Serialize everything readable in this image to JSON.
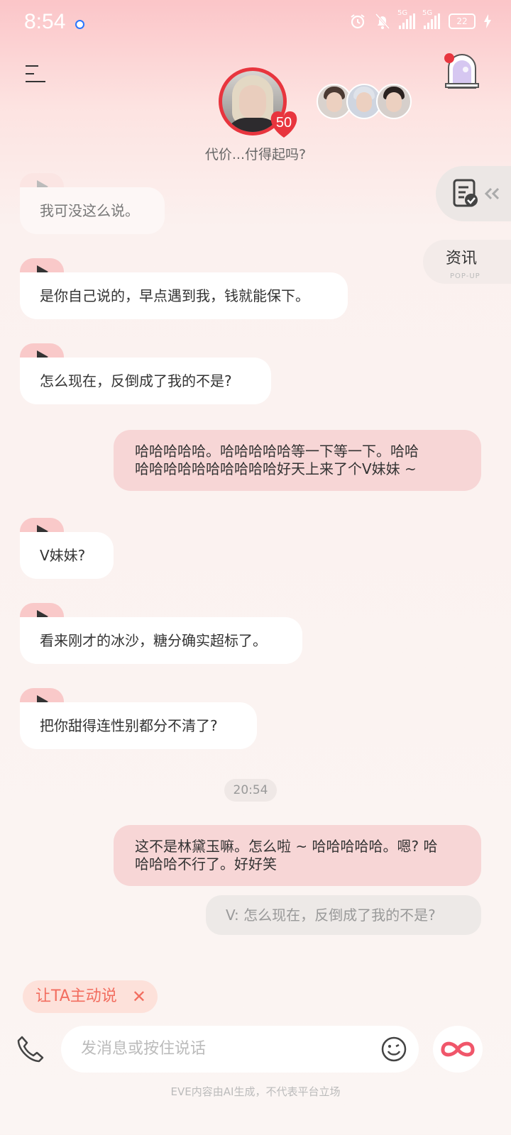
{
  "status_bar": {
    "time": "8:54",
    "network_1": "5G",
    "network_2": "5G",
    "battery": "22"
  },
  "header": {
    "affection_level": "50",
    "subtitle": "代价...付得起吗?",
    "icons": [
      "menu-icon",
      "door-portal-icon"
    ]
  },
  "side": {
    "news_label": "资讯",
    "news_sub": "POP-UP"
  },
  "messages": {
    "m1": "我可没这么说。",
    "m2": "是你自己说的，早点遇到我，钱就能保下。",
    "m3": "怎么现在，反倒成了我的不是?",
    "u1_line1": "哈哈哈哈哈。哈哈哈哈哈等一下等一下。哈哈",
    "u1_line2": "哈哈哈哈哈哈哈哈哈哈好天上来了个V妹妹 ~",
    "m4": "V妹妹?",
    "m5": "看来刚才的冰沙，糖分确实超标了。",
    "m6": "把你甜得连性别都分不清了?",
    "timestamp": "20:54",
    "u2_line1": "这不是林黛玉嘛。怎么啦 ~ 哈哈哈哈哈。嗯? 哈",
    "u2_line2": "哈哈哈不行了。好好笑",
    "quote": "V: 怎么现在，反倒成了我的不是?"
  },
  "bottom": {
    "suggestion": "让TA主动说",
    "suggestion_close": "✕",
    "input_placeholder": "发消息或按住说话",
    "disclaimer": "EVE内容由AI生成，不代表平台立场"
  },
  "colors": {
    "accent": "#e8353e",
    "user_bubble": "#f7d6d6",
    "play_badge": "#f9c9c9",
    "suggest_text": "#f26d5f"
  }
}
